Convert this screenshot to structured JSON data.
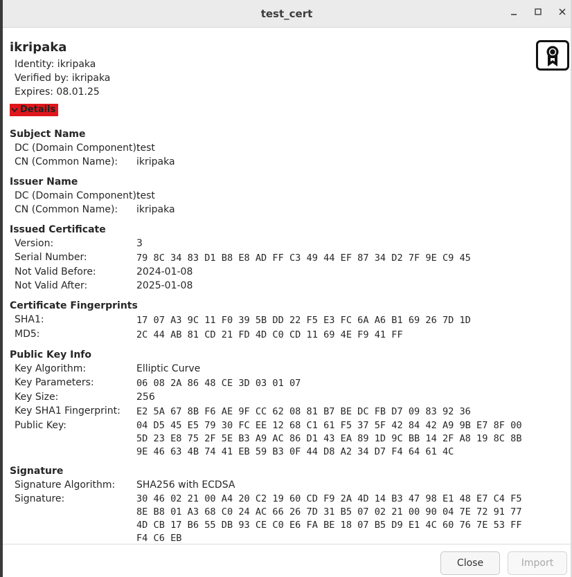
{
  "window": {
    "title": "test_cert"
  },
  "cert": {
    "name": "ikripaka",
    "identity": "Identity: ikripaka",
    "verified_by": "Verified by: ikripaka",
    "expires": "Expires: 08.01.25"
  },
  "details_label": "Details",
  "subject": {
    "heading": "Subject Name",
    "dc_label": "DC (Domain Component):",
    "dc_value": "test",
    "cn_label": "CN (Common Name):",
    "cn_value": "ikripaka"
  },
  "issuer": {
    "heading": "Issuer Name",
    "dc_label": "DC (Domain Component):",
    "dc_value": "test",
    "cn_label": "CN (Common Name):",
    "cn_value": "ikripaka"
  },
  "issued": {
    "heading": "Issued Certificate",
    "version_label": "Version:",
    "version_value": "3",
    "serial_label": "Serial Number:",
    "serial_value": "79 8C 34 83 D1 B8 E8 AD FF C3 49 44 EF 87 34 D2 7F 9E C9 45",
    "not_before_label": "Not Valid Before:",
    "not_before_value": "2024-01-08",
    "not_after_label": "Not Valid After:",
    "not_after_value": "2025-01-08"
  },
  "fingerprints": {
    "heading": "Certificate Fingerprints",
    "sha1_label": "SHA1:",
    "sha1_value": "17 07 A3 9C 11 F0 39 5B DD 22 F5 E3 FC 6A A6 B1 69 26 7D 1D",
    "md5_label": "MD5:",
    "md5_value": "2C 44 AB 81 CD 21 FD 4D C0 CD 11 69 4E F9 41 FF"
  },
  "public_key": {
    "heading": "Public Key Info",
    "algorithm_label": "Key Algorithm:",
    "algorithm_value": "Elliptic Curve",
    "params_label": "Key Parameters:",
    "params_value": "06 08 2A 86 48 CE 3D 03 01 07",
    "size_label": "Key Size:",
    "size_value": "256",
    "sha1_fp_label": "Key SHA1 Fingerprint:",
    "sha1_fp_value": "E2 5A 67 8B F6 AE 9F CC 62 08 81 B7 BE DC FB D7 09 83 92 36",
    "key_label": "Public Key:",
    "key_value": "04 D5 45 E5 79 30 FC EE 12 68 C1 61 F5 37 5F 42 84 42 A9 9B E7 8F 00\n5D 23 E8 75 2F 5E B3 A9 AC 86 D1 43 EA 89 1D 9C BB 14 2F A8 19 8C 8B\n9E 46 63 4B 74 41 EB 59 B3 0F 44 D8 A2 34 D7 F4 64 61 4C"
  },
  "signature": {
    "heading": "Signature",
    "algorithm_label": "Signature Algorithm:",
    "algorithm_value": "SHA256 with ECDSA",
    "sig_label": "Signature:",
    "sig_value": "30 46 02 21 00 A4 20 C2 19 60 CD F9 2A 4D 14 B3 47 98 E1 48 E7 C4 F5\n8E B8 01 A3 68 C0 24 AC 66 26 7D 31 B5 07 02 21 00 90 04 7E 72 91 77\n4D CB 17 B6 55 DB 93 CE C0 E6 FA BE 18 07 B5 D9 E1 4C 60 76 7E 53 FF\nF4 C6 EB"
  },
  "buttons": {
    "close": "Close",
    "import": "Import"
  },
  "colors": {
    "details_highlight": "#e0161c"
  },
  "icons": {
    "minimize": "minimize-icon",
    "maximize": "maximize-icon",
    "close": "close-icon",
    "certificate": "certificate-icon",
    "expander": "chevron-down-icon"
  }
}
